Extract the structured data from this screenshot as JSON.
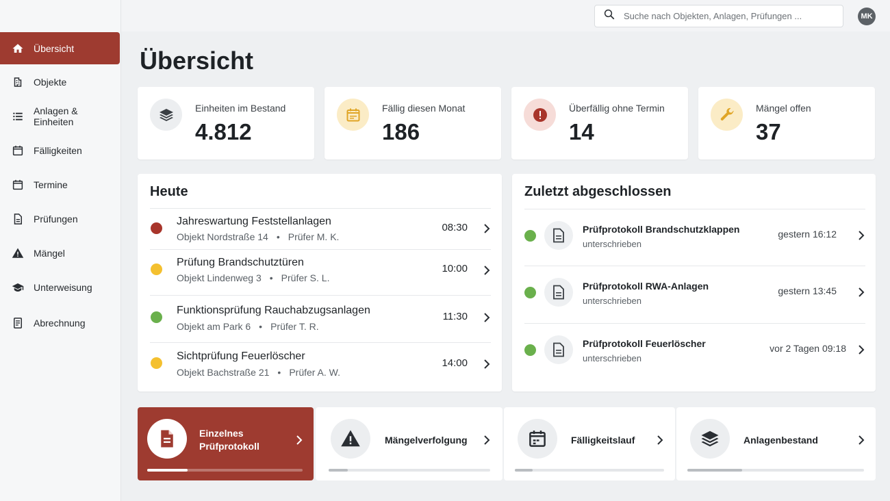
{
  "sidebar": {
    "items": [
      {
        "label": "Übersicht",
        "icon": "home-icon",
        "active": true
      },
      {
        "label": "Objekte",
        "icon": "building-icon"
      },
      {
        "label": "Anlagen & Einheiten",
        "icon": "list-icon"
      },
      {
        "label": "Fälligkeiten",
        "icon": "calendar-icon"
      },
      {
        "label": "Termine",
        "icon": "calendar-icon"
      },
      {
        "label": "Prüfungen",
        "icon": "document-icon"
      },
      {
        "label": "Mängel",
        "icon": "warning-icon"
      },
      {
        "label": "Unterweisung",
        "icon": "graduation-cap-icon"
      },
      {
        "label": "Abrechnung",
        "icon": "receipt-icon"
      }
    ]
  },
  "header": {
    "search_placeholder": "Suche nach Objekten, Anlagen, Prüfungen ...",
    "avatar_initials": "MK"
  },
  "page": {
    "title": "Übersicht"
  },
  "stats": [
    {
      "label": "Einheiten im Bestand",
      "value": "4.812",
      "icon": "layers-icon",
      "bg": "#eceef0",
      "fg": "#3a3f44"
    },
    {
      "label": "Fällig diesen Monat",
      "value": "186",
      "icon": "calendar-icon",
      "bg": "#fbecc6",
      "fg": "#e0a526"
    },
    {
      "label": "Überfällig ohne Termin",
      "value": "14",
      "icon": "alert-circle-icon",
      "bg": "#f6dcd8",
      "fg": "#a8352b"
    },
    {
      "label": "Mängel offen",
      "value": "37",
      "icon": "wrench-icon",
      "bg": "#fbecc6",
      "fg": "#e0a526"
    }
  ],
  "today": {
    "title": "Heute",
    "items": [
      {
        "title": "Jahreswartung Feststellanlagen",
        "object": "Objekt Nordstraße 14",
        "inspector": "Prüfer M. K.",
        "time": "08:30",
        "status_color": "#a8352b"
      },
      {
        "title": "Prüfung Brandschutztüren",
        "object": "Objekt Lindenweg 3",
        "inspector": "Prüfer S. L.",
        "time": "10:00",
        "status_color": "#f4c02f"
      },
      {
        "title": "Funktionsprüfung Rauchabzugsanlagen",
        "object": "Objekt am Park 6",
        "inspector": "Prüfer T. R.",
        "time": "11:30",
        "status_color": "#6ab04c"
      },
      {
        "title": "Sichtprüfung Feuerlöscher",
        "object": "Objekt Bachstraße 21",
        "inspector": "Prüfer A. W.",
        "time": "14:00",
        "status_color": "#f4c02f"
      }
    ],
    "separator": "•"
  },
  "recent": {
    "title": "Zuletzt abgeschlossen",
    "items": [
      {
        "title": "Prüfprotokoll Brandschutzklappen",
        "subtitle": "unterschrieben",
        "when": "gestern 16:12",
        "status_color": "#6ab04c"
      },
      {
        "title": "Prüfprotokoll RWA-Anlagen",
        "subtitle": "unterschrieben",
        "when": "gestern 13:45",
        "status_color": "#6ab04c"
      },
      {
        "title": "Prüfprotokoll Feuerlöscher",
        "subtitle": "unterschrieben",
        "when": "vor 2 Tagen 09:18",
        "status_color": "#6ab04c"
      }
    ]
  },
  "quick_actions": [
    {
      "label_line1": "Einzelnes",
      "label_line2": "Prüfprotokoll",
      "icon": "document-icon",
      "active": true,
      "progress": 0.26
    },
    {
      "label_line1": "Mängelverfolgung",
      "label_line2": "",
      "icon": "warning-icon",
      "active": false,
      "progress": 0.12
    },
    {
      "label_line1": "Fälligkeitslauf",
      "label_line2": "",
      "icon": "calendar-icon",
      "active": false,
      "progress": 0.12
    },
    {
      "label_line1": "Anlagenbestand",
      "label_line2": "",
      "icon": "layers-icon",
      "active": false,
      "progress": 0.31
    }
  ],
  "colors": {
    "accent": "#9e3b30",
    "green": "#6ab04c",
    "yellow": "#f4c02f",
    "red": "#a8352b"
  }
}
